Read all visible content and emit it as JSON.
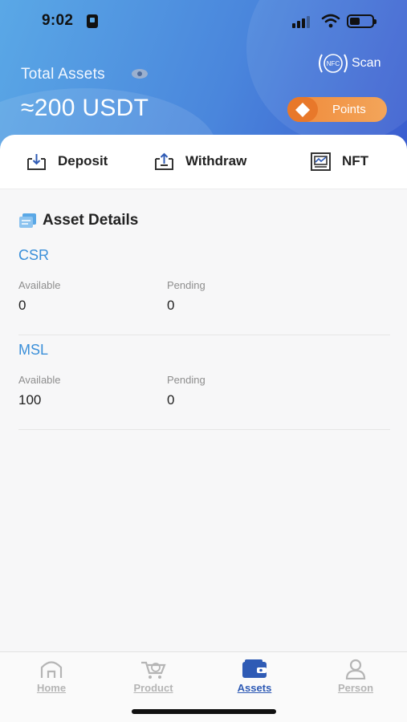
{
  "status_bar": {
    "time": "9:02"
  },
  "header": {
    "total_label": "Total Assets",
    "total_value": "≈200 USDT",
    "scan_label": "Scan",
    "nfc_text": "NFC",
    "points_label": "Points"
  },
  "actions": [
    {
      "label": "Deposit",
      "icon": "deposit-icon"
    },
    {
      "label": "Withdraw",
      "icon": "withdraw-icon"
    },
    {
      "label": "NFT",
      "icon": "nft-icon"
    }
  ],
  "asset_details": {
    "title": "Asset Details",
    "assets": [
      {
        "name": "CSR",
        "available_label": "Available",
        "available": "0",
        "pending_label": "Pending",
        "pending": "0"
      },
      {
        "name": "MSL",
        "available_label": "Available",
        "available": "100",
        "pending_label": "Pending",
        "pending": "0"
      }
    ]
  },
  "tabbar": {
    "tabs": [
      {
        "label": "Home",
        "icon": "home-icon",
        "active": false
      },
      {
        "label": "Product",
        "icon": "cart-icon",
        "active": false
      },
      {
        "label": "Assets",
        "icon": "wallet-icon",
        "active": true
      },
      {
        "label": "Person",
        "icon": "person-icon",
        "active": false
      }
    ]
  },
  "colors": {
    "header_gradient_start": "#5aa8e6",
    "header_gradient_end": "#3a5ccf",
    "points_orange": "#f08a3a",
    "asset_name_blue": "#3a8fd9",
    "tab_active": "#2f5bb5",
    "tab_inactive": "#b5b5b5"
  }
}
